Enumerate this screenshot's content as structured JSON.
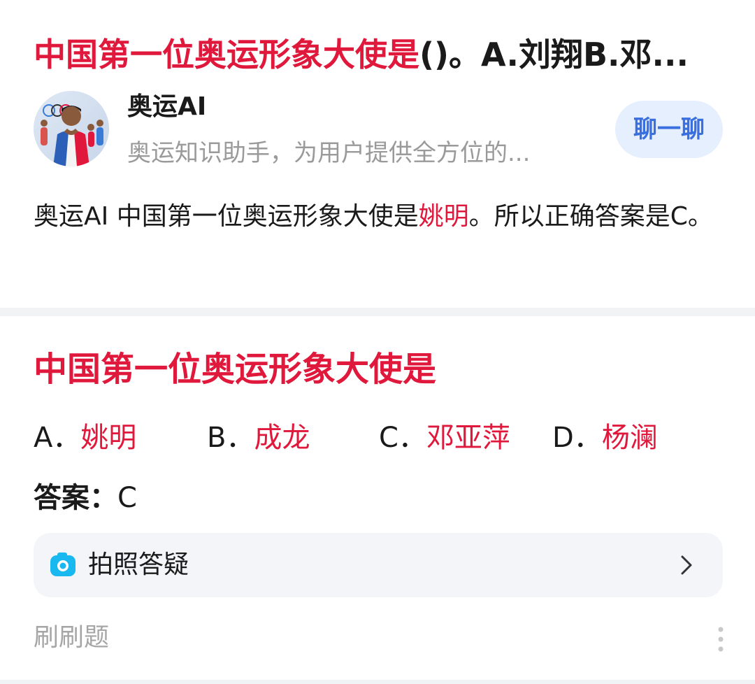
{
  "result1": {
    "title_highlight": "中国第一位奥运形象大使是",
    "title_rest": "()。A.刘翔B.邓",
    "title_ellipsis": "...",
    "bot": {
      "name": "奥运AI",
      "description": "奥运知识助手，为用户提供全方位的...",
      "chat_button": "聊一聊"
    },
    "answer_prefix": "奥运AI 中国第一位奥运形象大使是",
    "answer_highlight": "姚明",
    "answer_suffix": "。所以正确答案是C。"
  },
  "result2": {
    "title": "中国第一位奥运形象大使是",
    "options": [
      {
        "letter": "A．",
        "value": "姚明"
      },
      {
        "letter": "B．",
        "value": "成龙"
      },
      {
        "letter": "C．",
        "value": "邓亚萍"
      },
      {
        "letter": "D．",
        "value": "杨澜"
      }
    ],
    "answer_label": "答案：",
    "answer_value": "C",
    "photo_qa": "拍照答疑",
    "footer": "刷刷题"
  },
  "colors": {
    "highlight_red": "#e0183c",
    "chat_blue": "#3a6fe0",
    "camera_cyan": "#1ab8f0"
  },
  "icons": [
    "bot-avatar",
    "camera-icon",
    "chevron-right-icon",
    "more-vertical-icon"
  ]
}
